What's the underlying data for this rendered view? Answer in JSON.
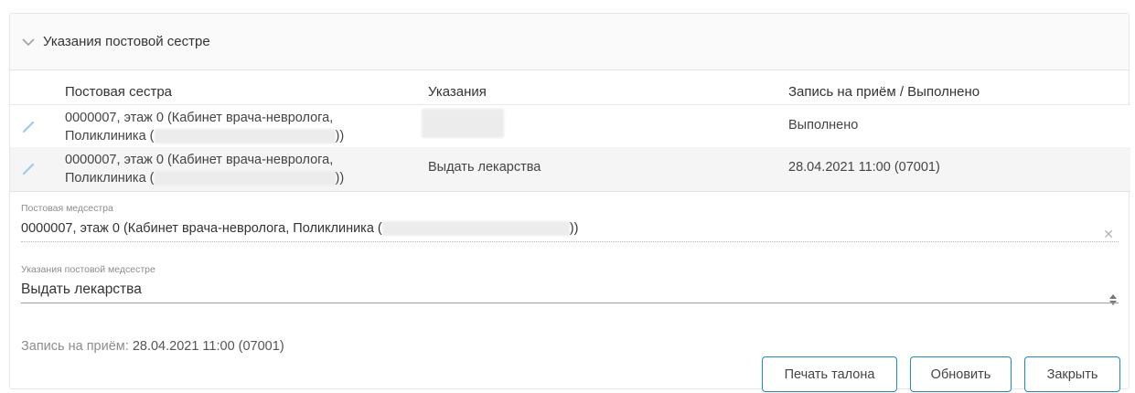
{
  "section": {
    "title": "Указания постовой сестре"
  },
  "table": {
    "columns": [
      "Постовая сестра",
      "Указания",
      "Запись на приём / Выполнено"
    ],
    "rows": [
      {
        "nurse_line1": "0000007, этаж 0 (Кабинет врача-невролога,",
        "nurse_line2_prefix": "Поликлиника (",
        "nurse_line2_suffix": "))",
        "instruction": "",
        "status": "Выполнено"
      },
      {
        "nurse_line1": "0000007, этаж 0 (Кабинет врача-невролога,",
        "nurse_line2_prefix": "Поликлиника (",
        "nurse_line2_suffix": "))",
        "instruction": "Выдать лекарства",
        "status": "28.04.2021 11:00 (07001)"
      }
    ]
  },
  "form": {
    "nurse_label": "Постовая медсестра",
    "nurse_value_prefix": "0000007, этаж 0 (Кабинет врача-невролога, Поликлиника (",
    "nurse_value_suffix": "))",
    "instructions_label": "Указания постовой медсестре",
    "instructions_value": "Выдать лекарства",
    "appointment_label": "Запись на приём:",
    "appointment_value": "28.04.2021 11:00 (07001)"
  },
  "buttons": {
    "print": "Печать талона",
    "refresh": "Обновить",
    "close": "Закрыть"
  },
  "icons": {
    "collapse": "chevron-down-icon",
    "edit": "pencil-icon",
    "clear": "close-icon",
    "spinner": "spinner-arrows-icon"
  },
  "colors": {
    "accent": "#1e88c7",
    "edit_icon": "#9ecbea"
  }
}
